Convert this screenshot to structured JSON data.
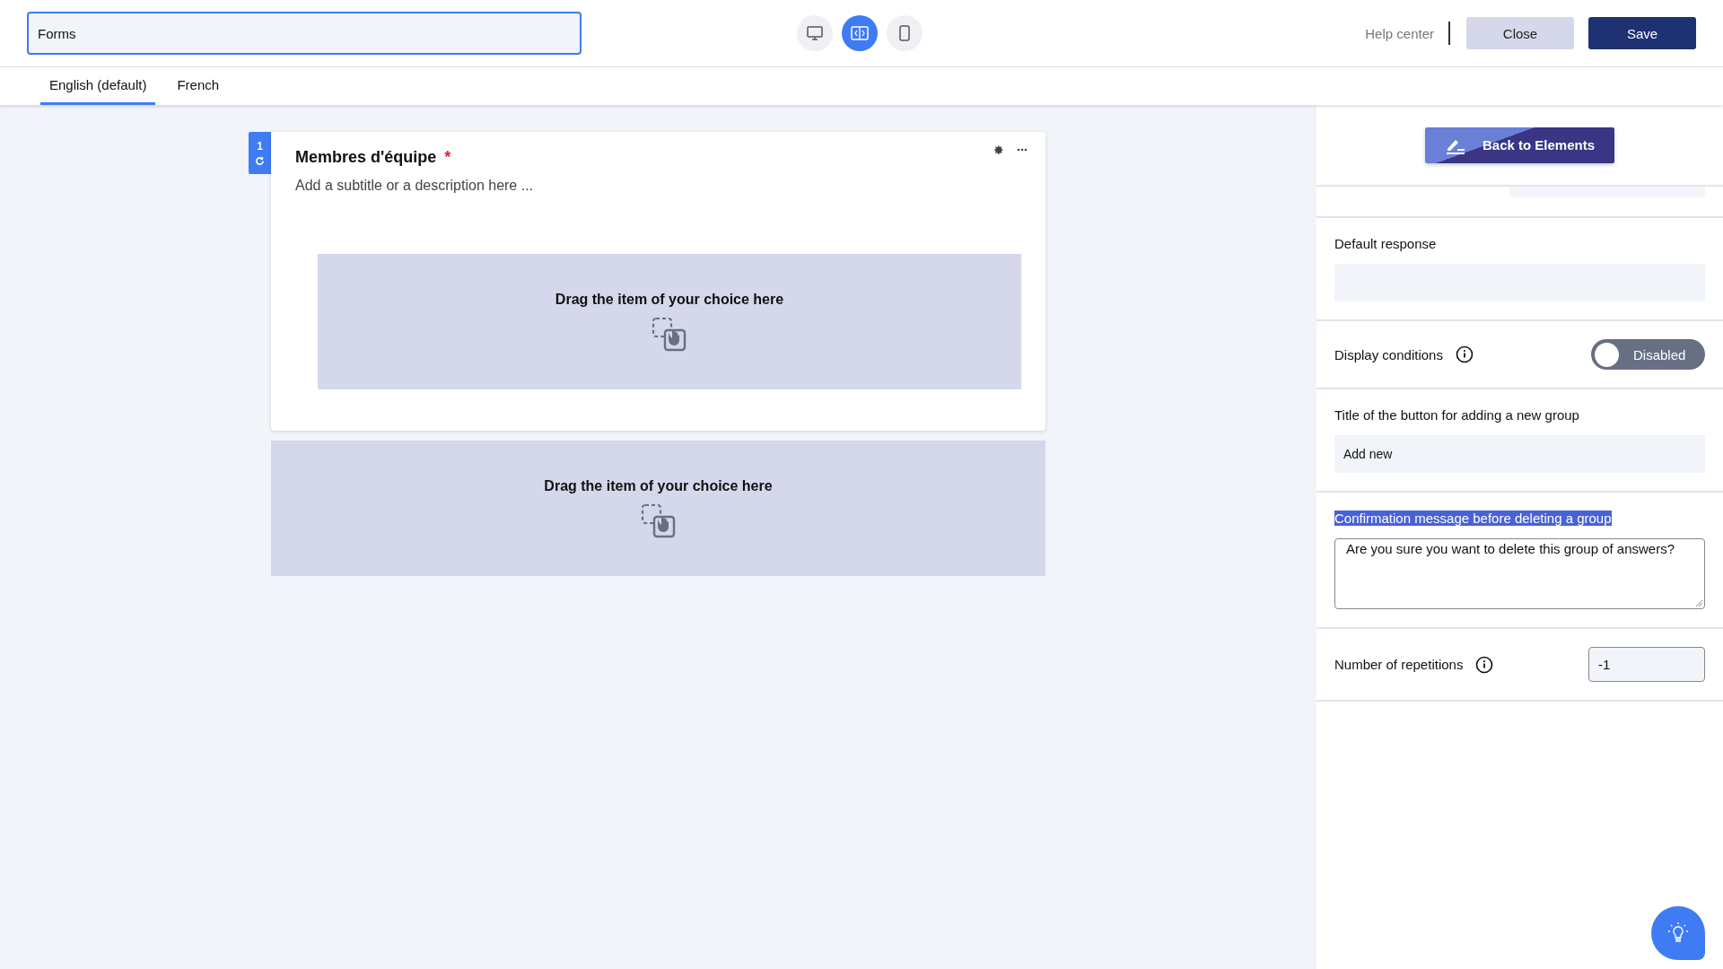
{
  "header": {
    "title_field": {
      "value": "Forms"
    },
    "view_modes": [
      {
        "kind": "desktop",
        "selected": false
      },
      {
        "kind": "split",
        "selected": true
      },
      {
        "kind": "mobile",
        "selected": false
      }
    ],
    "help_link": "Help center",
    "buttons": [
      {
        "label": "Close",
        "kind": "secondary"
      },
      {
        "label": "Save",
        "kind": "primary"
      }
    ]
  },
  "tabs": [
    {
      "label": "English (default)",
      "selected": true
    },
    {
      "label": "French",
      "selected": false
    }
  ],
  "question": {
    "number": "1",
    "title": "Membres d'équipe",
    "required_mark": "*",
    "subtitle_placeholder": "Add a subtitle or a description here ..."
  },
  "drop_zones": [
    "Drag the item of your choice here",
    "Drag the item of your choice here"
  ],
  "panel": {
    "back_button": "Back to Elements",
    "fields": [
      {
        "kind": "input",
        "label": "Default response",
        "highlighted": false
      },
      {
        "kind": "toggle",
        "label": "Display conditions",
        "info": true,
        "on": false,
        "toggle_label": "Disabled",
        "highlighted": false
      },
      {
        "kind": "input",
        "label": "Title of the button for adding a new group",
        "value": "Add new",
        "highlighted": false
      },
      {
        "kind": "textarea",
        "label": "Confirmation message before deleting a group",
        "value": "Are you sure you want to delete this group of answers?",
        "highlighted": true
      },
      {
        "kind": "number",
        "label": "Number of repetitions",
        "info": true,
        "value": "-1",
        "highlighted": false
      }
    ]
  }
}
